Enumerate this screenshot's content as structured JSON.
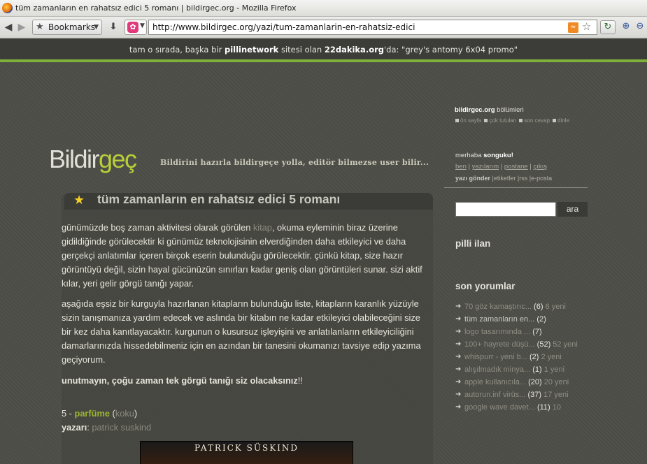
{
  "browser": {
    "window_title": "tüm zamanların en rahatsız edici 5 romanı | bildirgec.org - Mozilla Firefox",
    "bookmarks_label": "Bookmarks",
    "url": "http://www.bildirgec.org/yazi/tum-zamanlarin-en-rahatsiz-edici"
  },
  "network_banner": {
    "prefix": "tam o sırada, başka bir ",
    "network": "pillinetwork",
    "middle": " sitesi olan ",
    "site": "22dakika.org",
    "suffix": "'da: \"grey's antomy 6x04 promo\""
  },
  "header": {
    "logo_part1": "Bildir",
    "logo_part2": "geç",
    "slogan": "Bildirini hazırla bildirgeçe yolla, editör bilmezse user bilir..."
  },
  "article": {
    "title": "tüm zamanların en rahatsız edici 5 romanı",
    "p1_a": "günümüzde boş zaman aktivitesi olarak görülen ",
    "p1_kw": "kitap",
    "p1_b": ", okuma eyleminin biraz üzerine gidildiğinde görülecektir ki günümüz teknolojisinin elverdiğinden daha etkileyici ve daha gerçekçi anlatımlar içeren birçok eserin bulunduğu görülecektir. çünkü kitap, size hazır görüntüyü değil, sizin hayal gücünüzün sınırları kadar geniş olan görüntüleri sunar. sizi aktif kılar, yeri gelir görgü tanığı yapar.",
    "p2": "aşağıda eşsiz bir kurguyla hazırlanan kitapların bulunduğu liste, kitapların karanlık yüzüyle sizin tanışmanıza yardım edecek ve aslında bir kitabın ne kadar etkileyici olabileceğini size bir kez daha kanıtlayacaktır. kurgunun o kusursuz işleyişini ve anlatılanların etkileyiciliğini damarlarınızda hissedebilmeniz için en azından bir tanesini okumanızı tavsiye edip yazıma geçiyorum.",
    "p3": "unutmayın, çoğu zaman tek görgü tanığı siz olacaksınız",
    "p3_tail": "!!",
    "book_rank": "5 - ",
    "book_title": "parfüme",
    "book_alt_open": " (",
    "book_alt": "koku",
    "book_alt_close": ")",
    "author_label": "yazarı",
    "author_sep": ": ",
    "author": "patrick suskind",
    "cover_text": "PATRICK SÜSKIND"
  },
  "sidebar": {
    "sections_site": "bildirgec.org",
    "sections_label": " bölümleri",
    "section_links": [
      "ön sayfa",
      "çok tutulan",
      "son cevap",
      "dinle"
    ],
    "hello_prefix": "merhaba ",
    "username": "songuku!",
    "user_links": [
      "ben",
      "yazılarım",
      "postane",
      "çıkış"
    ],
    "user_links2": [
      "yazı gönder",
      "etiketler",
      "rss",
      "e-posta"
    ],
    "search_button": "ara",
    "pilli_ilan": "pilli ilan",
    "son_yorumlar": "son yorumlar",
    "comments": [
      {
        "title": "70 göz kamaştırıc...",
        "count": "(6)",
        "new": "6 yeni"
      },
      {
        "title": "tüm zamanların en...",
        "count": "(2)",
        "new": ""
      },
      {
        "title": "logo tasarımında ...",
        "count": "(7)",
        "new": ""
      },
      {
        "title": "100+ hayrete düşü...",
        "count": "(52)",
        "new": "52 yeni"
      },
      {
        "title": "whispurr - yeni b...",
        "count": "(2)",
        "new": "2 yeni"
      },
      {
        "title": "alışılmadık minya...",
        "count": "(1)",
        "new": "1 yeni"
      },
      {
        "title": "apple kullanıcıla...",
        "count": "(20)",
        "new": "20 yeni"
      },
      {
        "title": "autorun.inf virüs...",
        "count": "(37)",
        "new": "17 yeni"
      },
      {
        "title": "google wave davet...",
        "count": "(11)",
        "new": "10"
      }
    ]
  }
}
